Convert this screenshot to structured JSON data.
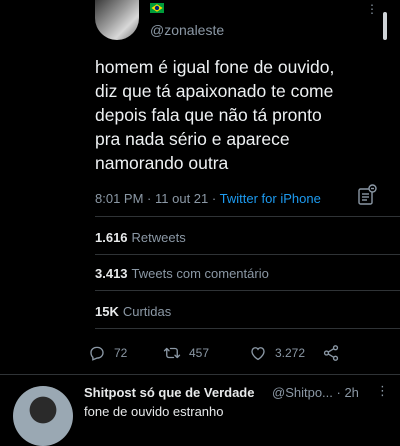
{
  "tweet": {
    "author_handle": "@zonaleste",
    "text": "homem é igual fone de ouvido,\ndiz que tá apaixonado te come\ndepois fala que não tá pronto\npra nada sério e aparece\nnamorando outra",
    "time": "8:01 PM",
    "date": "11 out 21",
    "source": "Twitter for iPhone",
    "separator": "·"
  },
  "stats": {
    "retweets_count": "1.616",
    "retweets_label": "Retweets",
    "quotes_count": "3.413",
    "quotes_label": "Tweets com comentário",
    "likes_count": "15K",
    "likes_label": "Curtidas"
  },
  "actions": {
    "replies": "72",
    "retweets": "457",
    "likes": "3.272"
  },
  "reply": {
    "name": "Shitpost só que de Verdade",
    "handle_time": "@Shitpo... · 2h",
    "text": "fone de ouvido estranho"
  },
  "colors": {
    "background": "#000000",
    "accent": "#1d9bf0",
    "muted": "#8b98a5",
    "flag_green": "#009c3b",
    "flag_yellow": "#ffdf00"
  },
  "icons": [
    "brazil-flag-icon",
    "more-icon",
    "analytics-icon",
    "reply-icon",
    "retweet-icon",
    "like-icon",
    "share-icon"
  ]
}
